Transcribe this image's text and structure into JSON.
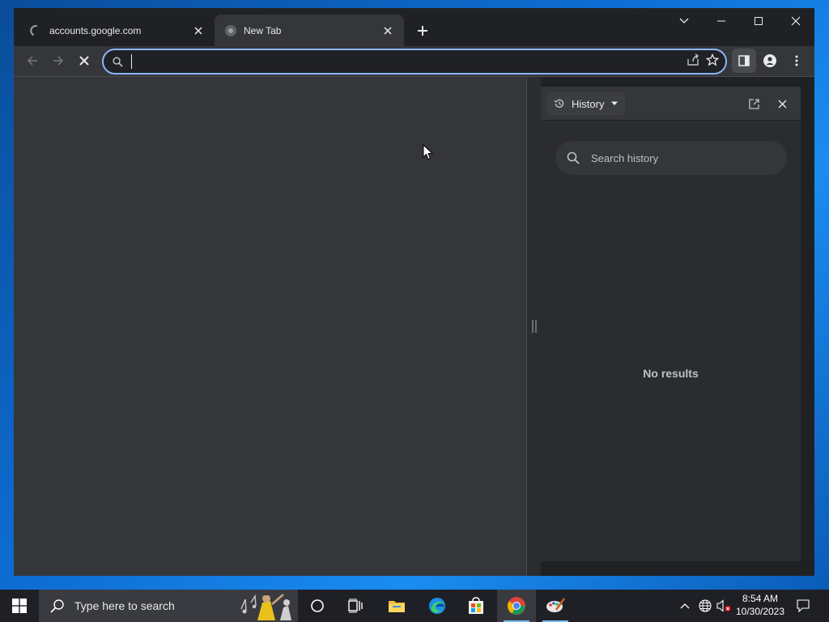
{
  "browser": {
    "tabs": [
      {
        "title": "accounts.google.com",
        "active": false,
        "loading": true
      },
      {
        "title": "New Tab",
        "active": true,
        "loading": false
      }
    ],
    "address_bar": {
      "value": "",
      "placeholder": ""
    }
  },
  "side_panel": {
    "dropdown_label": "History",
    "search_placeholder": "Search history",
    "empty_message": "No results"
  },
  "taskbar": {
    "search_placeholder": "Type here to search",
    "clock": {
      "time": "8:54 AM",
      "date": "10/30/2023"
    }
  },
  "colors": {
    "browser_frame": "#202124",
    "toolbar": "#35363a",
    "omnibox_focus": "#8ab4f8",
    "taskbar": "#1f2025",
    "desktop": "#0e6fd6"
  }
}
